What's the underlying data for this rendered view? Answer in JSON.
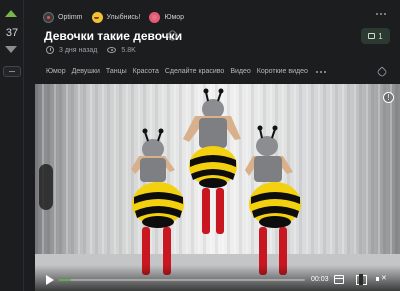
{
  "votes": {
    "count": "37"
  },
  "communities": [
    {
      "name": "Optimm",
      "icon": "optimm-avatar-icon"
    },
    {
      "name": "Улыбнись!",
      "icon": "smile-icon"
    },
    {
      "name": "Юмор",
      "icon": "humor-icon"
    }
  ],
  "post": {
    "title": "Девочки такие девочки",
    "time": "3 дня назад",
    "views": "5.8K",
    "comments": "1"
  },
  "tags": [
    "Юмор",
    "Девушки",
    "Танцы",
    "Красота",
    "Сделайте красиво",
    "Видео",
    "Короткие видео"
  ],
  "player": {
    "time": "00:03",
    "progress": 0.05,
    "accent": "#5fb04c"
  },
  "colors": {
    "upvote": "#79b74a",
    "background": "#1c1d1f"
  }
}
